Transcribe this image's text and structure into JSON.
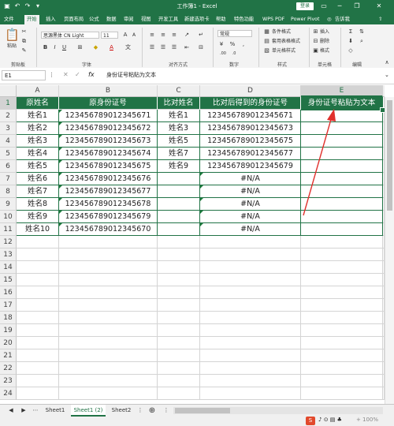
{
  "window": {
    "title": "工作簿1 - Excel",
    "login_label": "登录",
    "minimize": "─",
    "restore": "❐",
    "close": "✕"
  },
  "tabs": [
    "文件",
    "开始",
    "插入",
    "页面布局",
    "公式",
    "数据",
    "审阅",
    "视图",
    "开发工具",
    "新建选项卡",
    "帮助",
    "特色功能",
    "WPS PDF",
    "Power Pivot",
    "告诉我"
  ],
  "active_tab": "开始",
  "ribbon": {
    "paste_label": "粘贴",
    "clipboard_group": "剪贴板",
    "font_name": "思源黑体 CN Light",
    "font_size": "11",
    "font_group": "字体",
    "align_group": "对齐方式",
    "number_format": "常规",
    "number_group": "数字",
    "cond_format": "条件格式",
    "table_format": "套用表格格式",
    "cell_style": "单元格样式",
    "styles_group": "样式",
    "insert": "插入",
    "delete": "删除",
    "format": "格式",
    "cells_group": "单元格",
    "edit_group": "编辑",
    "bold": "B",
    "italic": "I",
    "underline": "U",
    "font_color": "A",
    "currency": "%",
    "comma": ","
  },
  "formula_bar": {
    "name_box": "E1",
    "fx": "fx",
    "content": "身份证号粘贴为文本"
  },
  "columns": [
    {
      "letter": "A"
    },
    {
      "letter": "B"
    },
    {
      "letter": "C"
    },
    {
      "letter": "D"
    },
    {
      "letter": "E"
    }
  ],
  "row_numbers": [
    "1",
    "2",
    "3",
    "4",
    "5",
    "6",
    "7",
    "8",
    "9",
    "10",
    "11",
    "12",
    "13",
    "14",
    "15",
    "16",
    "17",
    "18",
    "19",
    "20",
    "21",
    "22",
    "23",
    "24"
  ],
  "header_row": [
    "原姓名",
    "原身份证号",
    "比对姓名",
    "比对后得到的身份证号",
    "身份证号粘贴为文本"
  ],
  "data_rows": [
    [
      "姓名1",
      "123456789012345671",
      "姓名1",
      "123456789012345671",
      ""
    ],
    [
      "姓名2",
      "123456789012345672",
      "姓名3",
      "123456789012345673",
      ""
    ],
    [
      "姓名3",
      "123456789012345673",
      "姓名5",
      "123456789012345675",
      ""
    ],
    [
      "姓名4",
      "123456789012345674",
      "姓名7",
      "123456789012345677",
      ""
    ],
    [
      "姓名5",
      "123456789012345675",
      "姓名9",
      "123456789012345679",
      ""
    ],
    [
      "姓名6",
      "123456789012345676",
      "",
      "#N/A",
      ""
    ],
    [
      "姓名7",
      "123456789012345677",
      "",
      "#N/A",
      ""
    ],
    [
      "姓名8",
      "123456789012345678",
      "",
      "#N/A",
      ""
    ],
    [
      "姓名9",
      "123456789012345679",
      "",
      "#N/A",
      ""
    ],
    [
      "姓名10",
      "123456789012345670",
      "",
      "#N/A",
      ""
    ]
  ],
  "sheets": [
    "Sheet1",
    "Sheet1 (2)",
    "Sheet2"
  ],
  "active_sheet": "Sheet1 (2)",
  "add_sheet": "⊕",
  "colors": {
    "accent": "#217346",
    "arrow": "#e0302c"
  }
}
